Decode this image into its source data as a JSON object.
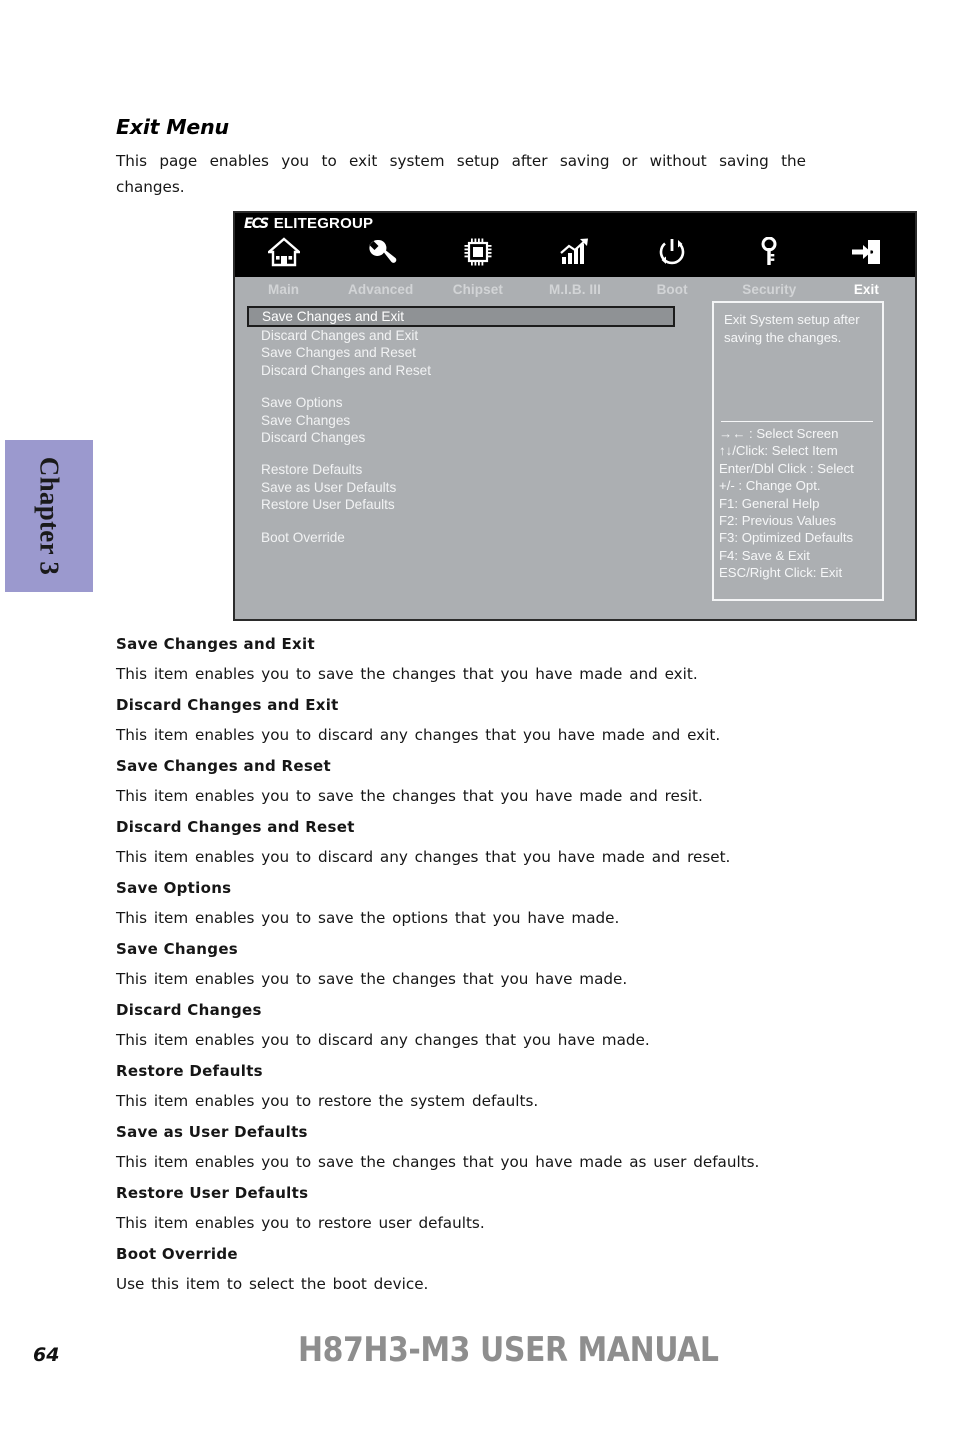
{
  "chapter_tab": {
    "label": "Chapter 3",
    "color": "#9b99ce"
  },
  "page": {
    "title": "Exit Menu",
    "intro": "This page enables you to exit system setup after saving or without saving the changes."
  },
  "bios": {
    "brand_mark": "ECS",
    "brand_name": "ELITEGROUP",
    "tabs": [
      {
        "label": "Main",
        "icon": "home-icon",
        "active": false
      },
      {
        "label": "Advanced",
        "icon": "wrench-icon",
        "active": false
      },
      {
        "label": "Chipset",
        "icon": "chip-icon",
        "active": false
      },
      {
        "label": "M.I.B. III",
        "icon": "bar-chart-icon",
        "active": false
      },
      {
        "label": "Boot",
        "icon": "power-icon",
        "active": false
      },
      {
        "label": "Security",
        "icon": "key-icon",
        "active": false
      },
      {
        "label": "Exit",
        "icon": "exit-door-icon",
        "active": true
      }
    ],
    "menu_items": [
      {
        "label": "Save Changes and Exit",
        "selected": true
      },
      {
        "label": "Discard Changes and Exit",
        "selected": false
      },
      {
        "label": "Save Changes and Reset",
        "selected": false
      },
      {
        "label": "Discard Changes and Reset",
        "selected": false
      },
      {
        "label": "",
        "spacer": true
      },
      {
        "label": "Save Options",
        "selected": false
      },
      {
        "label": "Save Changes",
        "selected": false
      },
      {
        "label": "Discard Changes",
        "selected": false
      },
      {
        "label": "",
        "spacer": true
      },
      {
        "label": "Restore Defaults",
        "selected": false
      },
      {
        "label": "Save as User Defaults",
        "selected": false
      },
      {
        "label": "Restore User Defaults",
        "selected": false
      },
      {
        "label": "",
        "spacer": true
      },
      {
        "label": "Boot Override",
        "selected": false
      }
    ],
    "help": {
      "description": "Exit System setup after saving the changes.",
      "keys": [
        "→←   : Select Screen",
        "↑↓/Click: Select Item",
        "Enter/Dbl Click : Select",
        "+/- : Change Opt.",
        "F1: General Help",
        "F2: Previous Values",
        "F3: Optimized Defaults",
        "F4: Save & Exit",
        "ESC/Right Click: Exit"
      ]
    },
    "colors": {
      "header_bg": "#000000",
      "body_bg": "#acafb2",
      "selected_bg": "#8f9295",
      "text": "#f2f3f4"
    }
  },
  "descriptions": [
    {
      "title": "Save Changes and Exit",
      "body": "This item enables you to save the changes that you have made and exit."
    },
    {
      "title": "Discard Changes and Exit",
      "body": "This item enables you to discard any changes that you have made and exit."
    },
    {
      "title": "Save Changes and Reset",
      "body": "This item enables you to save the changes that you have made and resit."
    },
    {
      "title": "Discard Changes and Reset",
      "body": "This item enables you to discard any changes that you have made and reset."
    },
    {
      "title": "Save Options",
      "body": "This item enables you to save the options that you have made."
    },
    {
      "title": "Save Changes",
      "body": "This item enables you to save the changes that you have made."
    },
    {
      "title": "Discard Changes",
      "body": "This item enables you to discard any changes that you have made."
    },
    {
      "title": "Restore Defaults",
      "body": "This item enables you to restore the system defaults."
    },
    {
      "title": "Save as User Defaults",
      "body": "This item enables you to save the changes that you have made as user defaults."
    },
    {
      "title": "Restore User Defaults",
      "body": "This item enables you to restore user defaults."
    },
    {
      "title": "Boot Override",
      "body": "Use this item to select the boot device."
    }
  ],
  "footer": {
    "page_number": "64",
    "manual_title": "H87H3-M3 USER MANUAL"
  }
}
